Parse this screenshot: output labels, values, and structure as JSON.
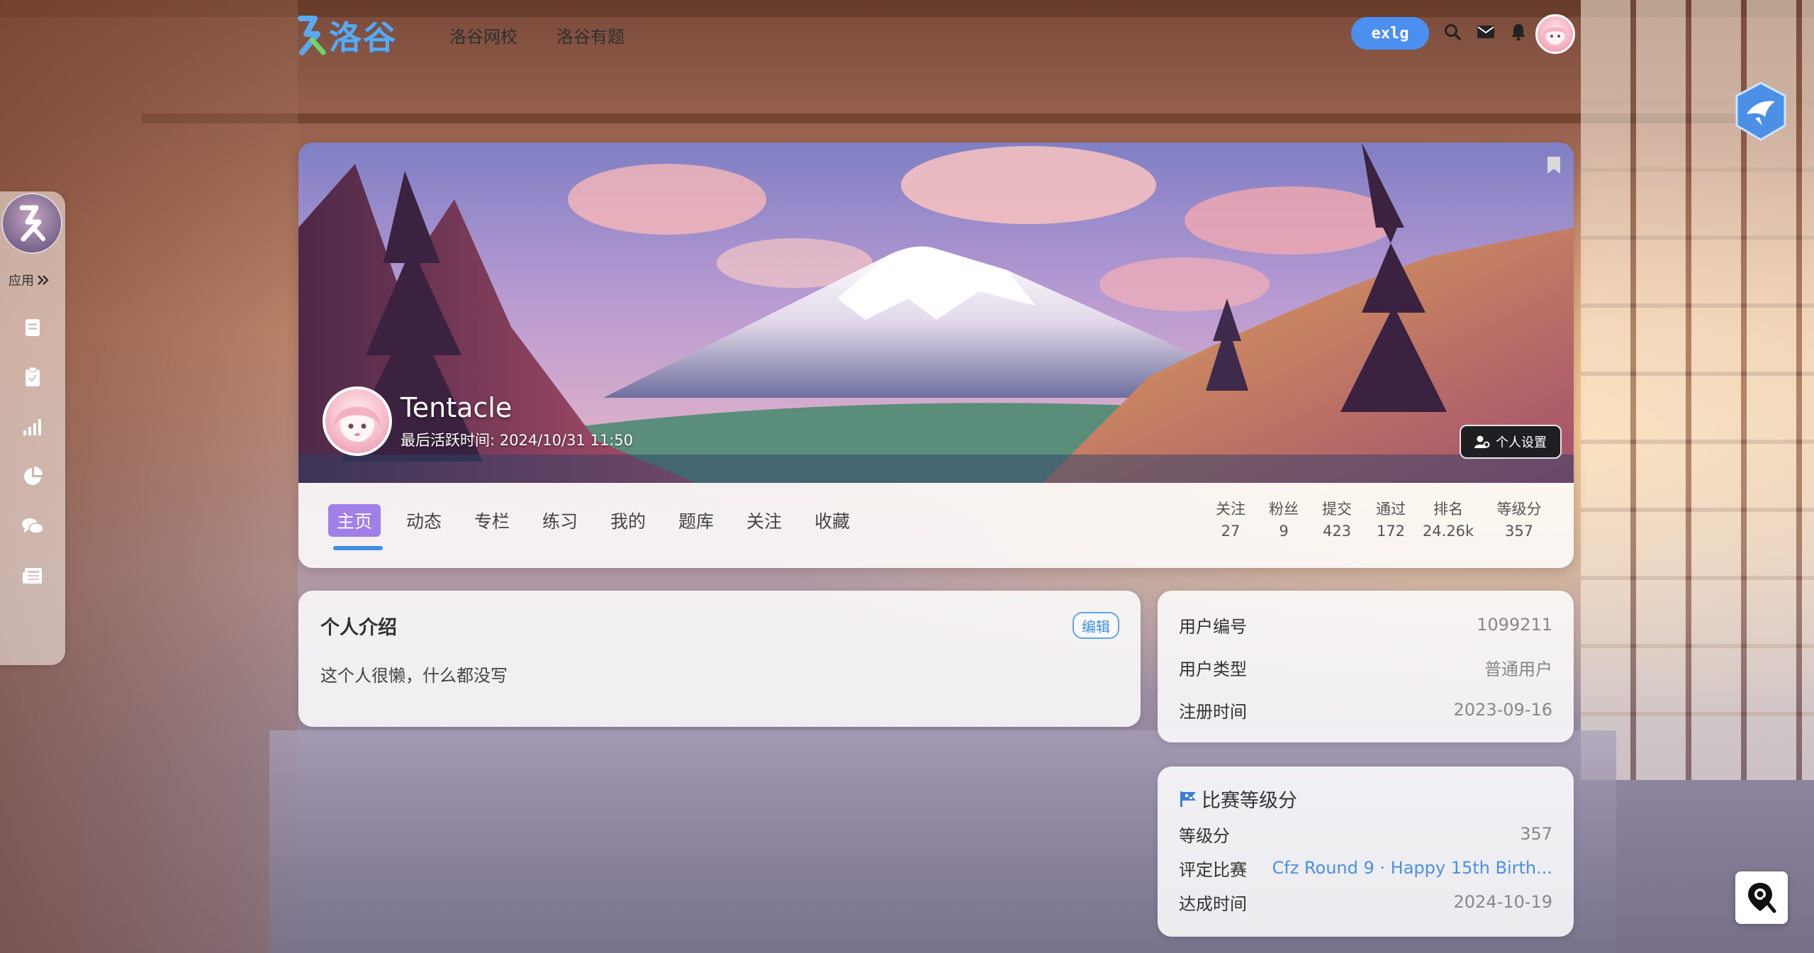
{
  "topnav": {
    "logo_text": "洛谷",
    "links": [
      "洛谷网校",
      "洛谷有题"
    ],
    "username_pill": "exlg",
    "icons": [
      "search-icon",
      "mail-icon",
      "bell-icon"
    ]
  },
  "sidebar": {
    "apps_label": "应用",
    "items": [
      "problem-list-icon",
      "clipboard-icon",
      "ranking-icon",
      "stats-icon",
      "chat-icon",
      "news-icon"
    ]
  },
  "profile": {
    "name": "Tentacle",
    "last_active": "最后活跃时间: 2024/10/31 11:50",
    "settings_label": "个人设置"
  },
  "tabs": [
    "主页",
    "动态",
    "专栏",
    "练习",
    "我的",
    "题库",
    "关注",
    "收藏"
  ],
  "stats": [
    {
      "label": "关注",
      "value": "27"
    },
    {
      "label": "粉丝",
      "value": "9"
    },
    {
      "label": "提交",
      "value": "423"
    },
    {
      "label": "通过",
      "value": "172"
    },
    {
      "label": "排名",
      "value": "24.26k"
    },
    {
      "label": "等级分",
      "value": "357"
    }
  ],
  "intro": {
    "title": "个人介绍",
    "edit_label": "编辑",
    "text": "这个人很懒，什么都没写"
  },
  "user_info": {
    "id_label": "用户编号",
    "id_value": "1099211",
    "type_label": "用户类型",
    "type_value": "普通用户",
    "reg_label": "注册时间",
    "reg_value": "2023-09-16"
  },
  "rating": {
    "title": "比赛等级分",
    "score_label": "等级分",
    "score_value": "357",
    "contest_label": "评定比赛",
    "contest_value": "Cfz Round 9 · Happy 15th Birth...",
    "date_label": "达成时间",
    "date_value": "2024-10-19"
  },
  "colors": {
    "accent": "#4b8ff0",
    "active_tab": "#a07fe6",
    "link": "#4a90e2"
  }
}
